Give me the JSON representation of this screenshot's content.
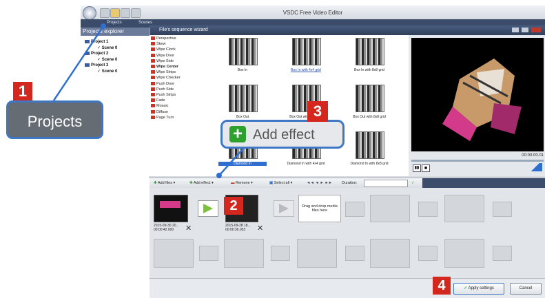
{
  "app": {
    "title": "VSDC Free Video Editor"
  },
  "menu": {
    "items": [
      "Projects",
      "Scenes"
    ]
  },
  "wizard": {
    "title": "File's sequence wizard"
  },
  "explorer": {
    "title": "Projects explorer",
    "tree": [
      {
        "label": "Project 1",
        "child": "Scene 0"
      },
      {
        "label": "Project 2",
        "child": "Scene 0"
      },
      {
        "label": "Project 3",
        "child": "Scene 0"
      }
    ]
  },
  "effects_list": [
    "Perspective",
    "Skew",
    "Wipe Clock",
    "Wipe Door",
    "Wipe Side",
    "Wipe Center",
    "Wipe Strips",
    "Wipe Checker",
    "Push Door",
    "Push Side",
    "Push Strips",
    "Fade",
    "Mosaic",
    "Diffuse",
    "Page Turn"
  ],
  "effects_selected": "Wipe Center",
  "thumbnails": [
    {
      "label": "Box In",
      "style": "normal"
    },
    {
      "label": "Box In with 4x4 grid",
      "style": "link"
    },
    {
      "label": "Box In with 8x8 grid",
      "style": "normal"
    },
    {
      "label": "Box Out",
      "style": "normal"
    },
    {
      "label": "Box Out with 4x4 grid",
      "style": "normal"
    },
    {
      "label": "Box Out with 8x8 grid",
      "style": "normal"
    },
    {
      "label": "Diamond In",
      "style": "selected"
    },
    {
      "label": "Diamond In with 4x4 grid",
      "style": "normal"
    },
    {
      "label": "Diamond In with 8x8 grid",
      "style": "normal"
    }
  ],
  "preview": {
    "timecode": "00:00:00.01"
  },
  "toolbar": {
    "add_files": "Add files",
    "add_effect": "Add effect",
    "remove": "Remove",
    "select_all": "Select all",
    "duration": "Duration:"
  },
  "timeline": {
    "clip1": {
      "date": "2015-09-30 20...",
      "time": "00:00:42.000"
    },
    "clip2": {
      "date": "2015-09-28 18...",
      "time": "00:00:36.033"
    },
    "drop_text": "Drag and drop media files here"
  },
  "footer": {
    "apply": "Apply settings",
    "cancel": "Cancel"
  },
  "callouts": {
    "projects": "Projects",
    "add_effect": "Add effect",
    "n1": "1",
    "n2": "2",
    "n3": "3",
    "n4": "4"
  },
  "colors": {
    "badge": "#d4281e",
    "callout_border": "#3e78c4",
    "accent_green": "#2ea02e"
  }
}
